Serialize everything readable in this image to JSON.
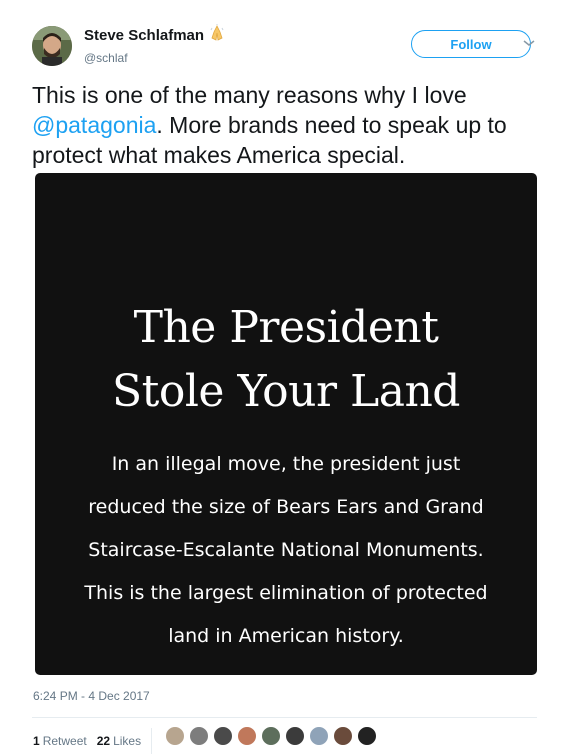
{
  "author": {
    "display_name": "Steve Schlafman",
    "handle": "@schlaf",
    "emoji_icon": "folded-hands-emoji"
  },
  "follow_label": "Follow",
  "tweet": {
    "text_before": "This is one of the many reasons why I love ",
    "mention": "@patagonia",
    "text_after": ". More brands need to speak up to protect what makes America special."
  },
  "media": {
    "title_line1": "The President",
    "title_line2": "Stole Your Land",
    "body": "In an illegal move, the president just reduced the size of Bears Ears and Grand Staircase-Escalante National Monuments. This is the largest elimination of protected land in American history."
  },
  "timestamp": "6:24 PM - 4 Dec 2017",
  "stats": {
    "retweets_count": "1",
    "retweets_label": "Retweet",
    "likes_count": "22",
    "likes_label": "Likes"
  },
  "colors": {
    "accent": "#1da1f2",
    "muted": "#657786",
    "text": "#14171a",
    "media_bg": "#111111"
  },
  "likers": [
    "#b7a58f",
    "#7d7d7d",
    "#4a4a4a",
    "#c0785b",
    "#5d6e5c",
    "#3b3b3b",
    "#8fa3b8",
    "#6a4b3b",
    "#222222"
  ]
}
